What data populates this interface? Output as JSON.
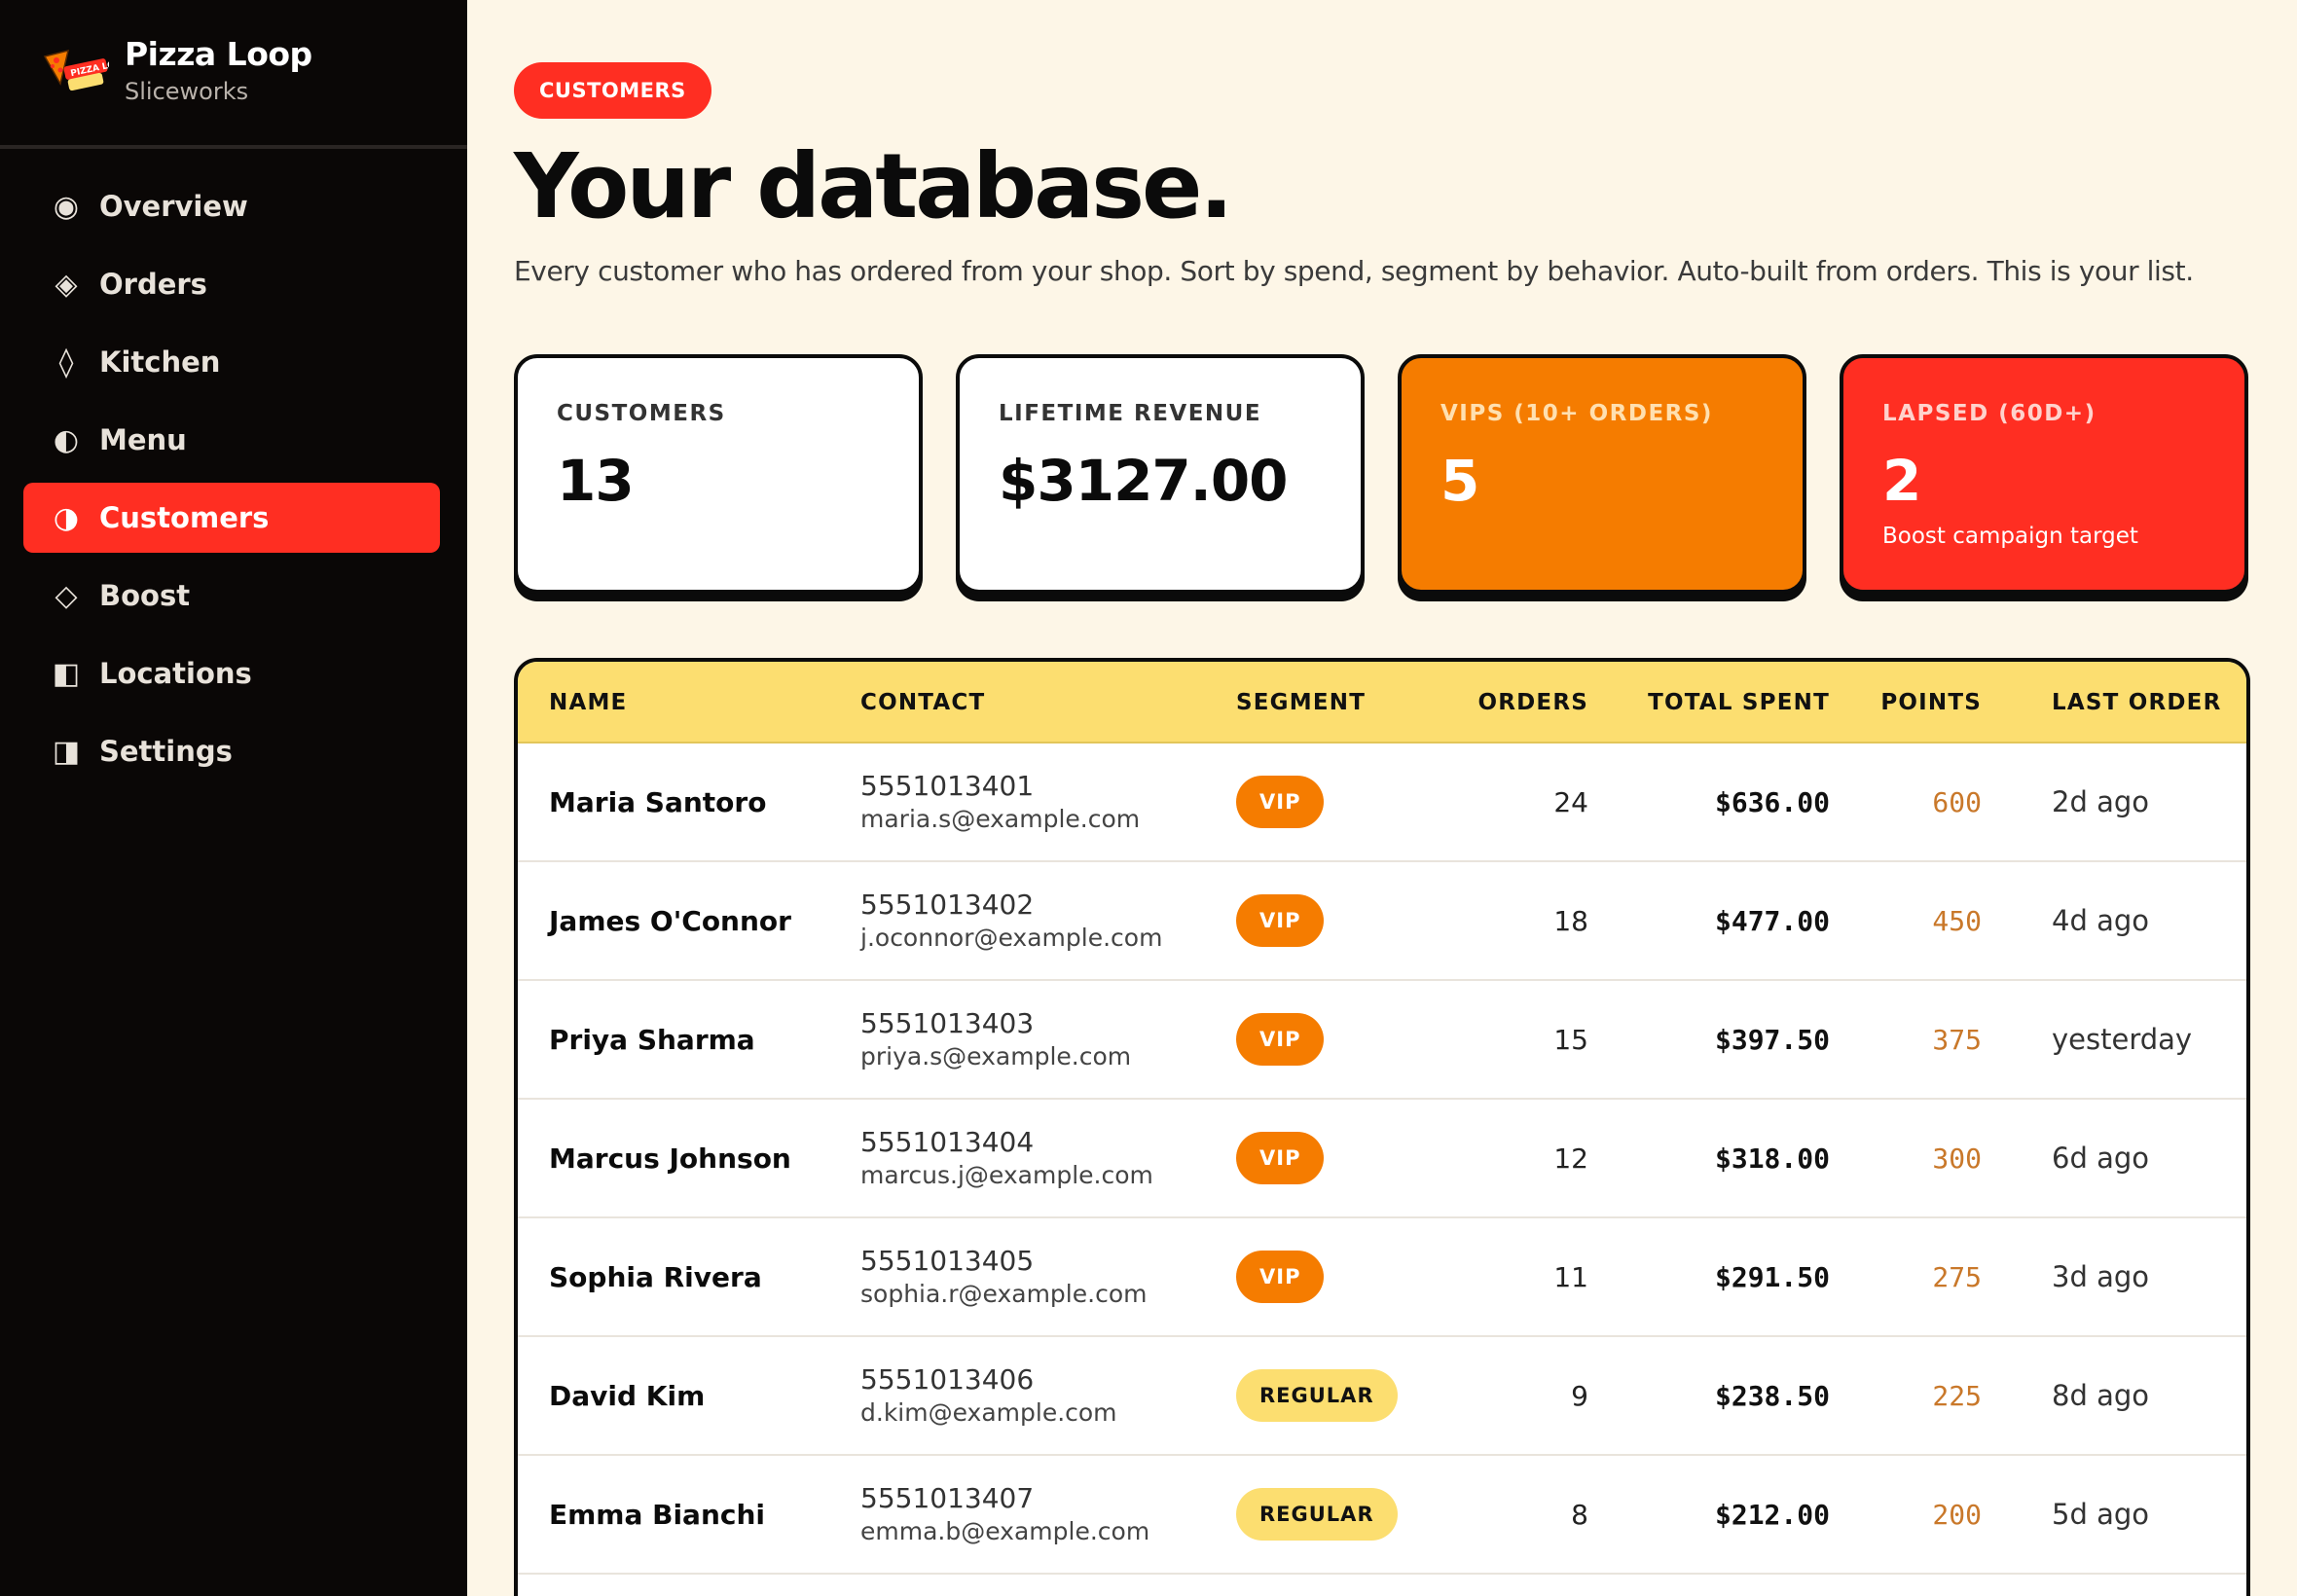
{
  "brand": {
    "name": "Pizza Loop",
    "subtitle": "Sliceworks",
    "logo_text": "PIZZA LOOP"
  },
  "nav": {
    "items": [
      {
        "label": "Overview",
        "icon": "◉",
        "icon_name": "overview-icon"
      },
      {
        "label": "Orders",
        "icon": "◈",
        "icon_name": "orders-icon"
      },
      {
        "label": "Kitchen",
        "icon": "◊",
        "icon_name": "kitchen-icon"
      },
      {
        "label": "Menu",
        "icon": "◐",
        "icon_name": "menu-icon"
      },
      {
        "label": "Customers",
        "icon": "◑",
        "icon_name": "customers-icon",
        "active": true
      },
      {
        "label": "Boost",
        "icon": "◇",
        "icon_name": "boost-icon"
      },
      {
        "label": "Locations",
        "icon": "◧",
        "icon_name": "locations-icon"
      },
      {
        "label": "Settings",
        "icon": "◨",
        "icon_name": "settings-icon"
      }
    ]
  },
  "header": {
    "badge": "CUSTOMERS",
    "title": "Your database.",
    "description": "Every customer who has ordered from your shop. Sort by spend, segment by behavior. Auto-built from orders. This is your list."
  },
  "stats": {
    "customers": {
      "label": "CUSTOMERS",
      "value": "13"
    },
    "revenue": {
      "label": "LIFETIME REVENUE",
      "value": "$3127.00"
    },
    "vips": {
      "label": "VIPS (10+ ORDERS)",
      "value": "5"
    },
    "lapsed": {
      "label": "LAPSED (60D+)",
      "value": "2",
      "note": "Boost campaign target"
    }
  },
  "table": {
    "headers": {
      "name": "NAME",
      "contact": "CONTACT",
      "segment": "SEGMENT",
      "orders": "ORDERS",
      "spent": "TOTAL SPENT",
      "points": "POINTS",
      "last": "LAST ORDER"
    },
    "rows": [
      {
        "name": "Maria Santoro",
        "phone": "5551013401",
        "email": "maria.s@example.com",
        "segment": "VIP",
        "orders": "24",
        "spent": "$636.00",
        "points": "600",
        "last": "2d ago"
      },
      {
        "name": "James O'Connor",
        "phone": "5551013402",
        "email": "j.oconnor@example.com",
        "segment": "VIP",
        "orders": "18",
        "spent": "$477.00",
        "points": "450",
        "last": "4d ago"
      },
      {
        "name": "Priya Sharma",
        "phone": "5551013403",
        "email": "priya.s@example.com",
        "segment": "VIP",
        "orders": "15",
        "spent": "$397.50",
        "points": "375",
        "last": "yesterday"
      },
      {
        "name": "Marcus Johnson",
        "phone": "5551013404",
        "email": "marcus.j@example.com",
        "segment": "VIP",
        "orders": "12",
        "spent": "$318.00",
        "points": "300",
        "last": "6d ago"
      },
      {
        "name": "Sophia Rivera",
        "phone": "5551013405",
        "email": "sophia.r@example.com",
        "segment": "VIP",
        "orders": "11",
        "spent": "$291.50",
        "points": "275",
        "last": "3d ago"
      },
      {
        "name": "David Kim",
        "phone": "5551013406",
        "email": "d.kim@example.com",
        "segment": "REGULAR",
        "orders": "9",
        "spent": "$238.50",
        "points": "225",
        "last": "8d ago"
      },
      {
        "name": "Emma Bianchi",
        "phone": "5551013407",
        "email": "emma.b@example.com",
        "segment": "REGULAR",
        "orders": "8",
        "spent": "$212.00",
        "points": "200",
        "last": "5d ago"
      }
    ]
  },
  "colors": {
    "accent_red": "#FF2E22",
    "accent_orange": "#F57C00",
    "header_yellow": "#FCDE70",
    "background": "#FDF6E7",
    "sidebar": "#0A0706"
  }
}
